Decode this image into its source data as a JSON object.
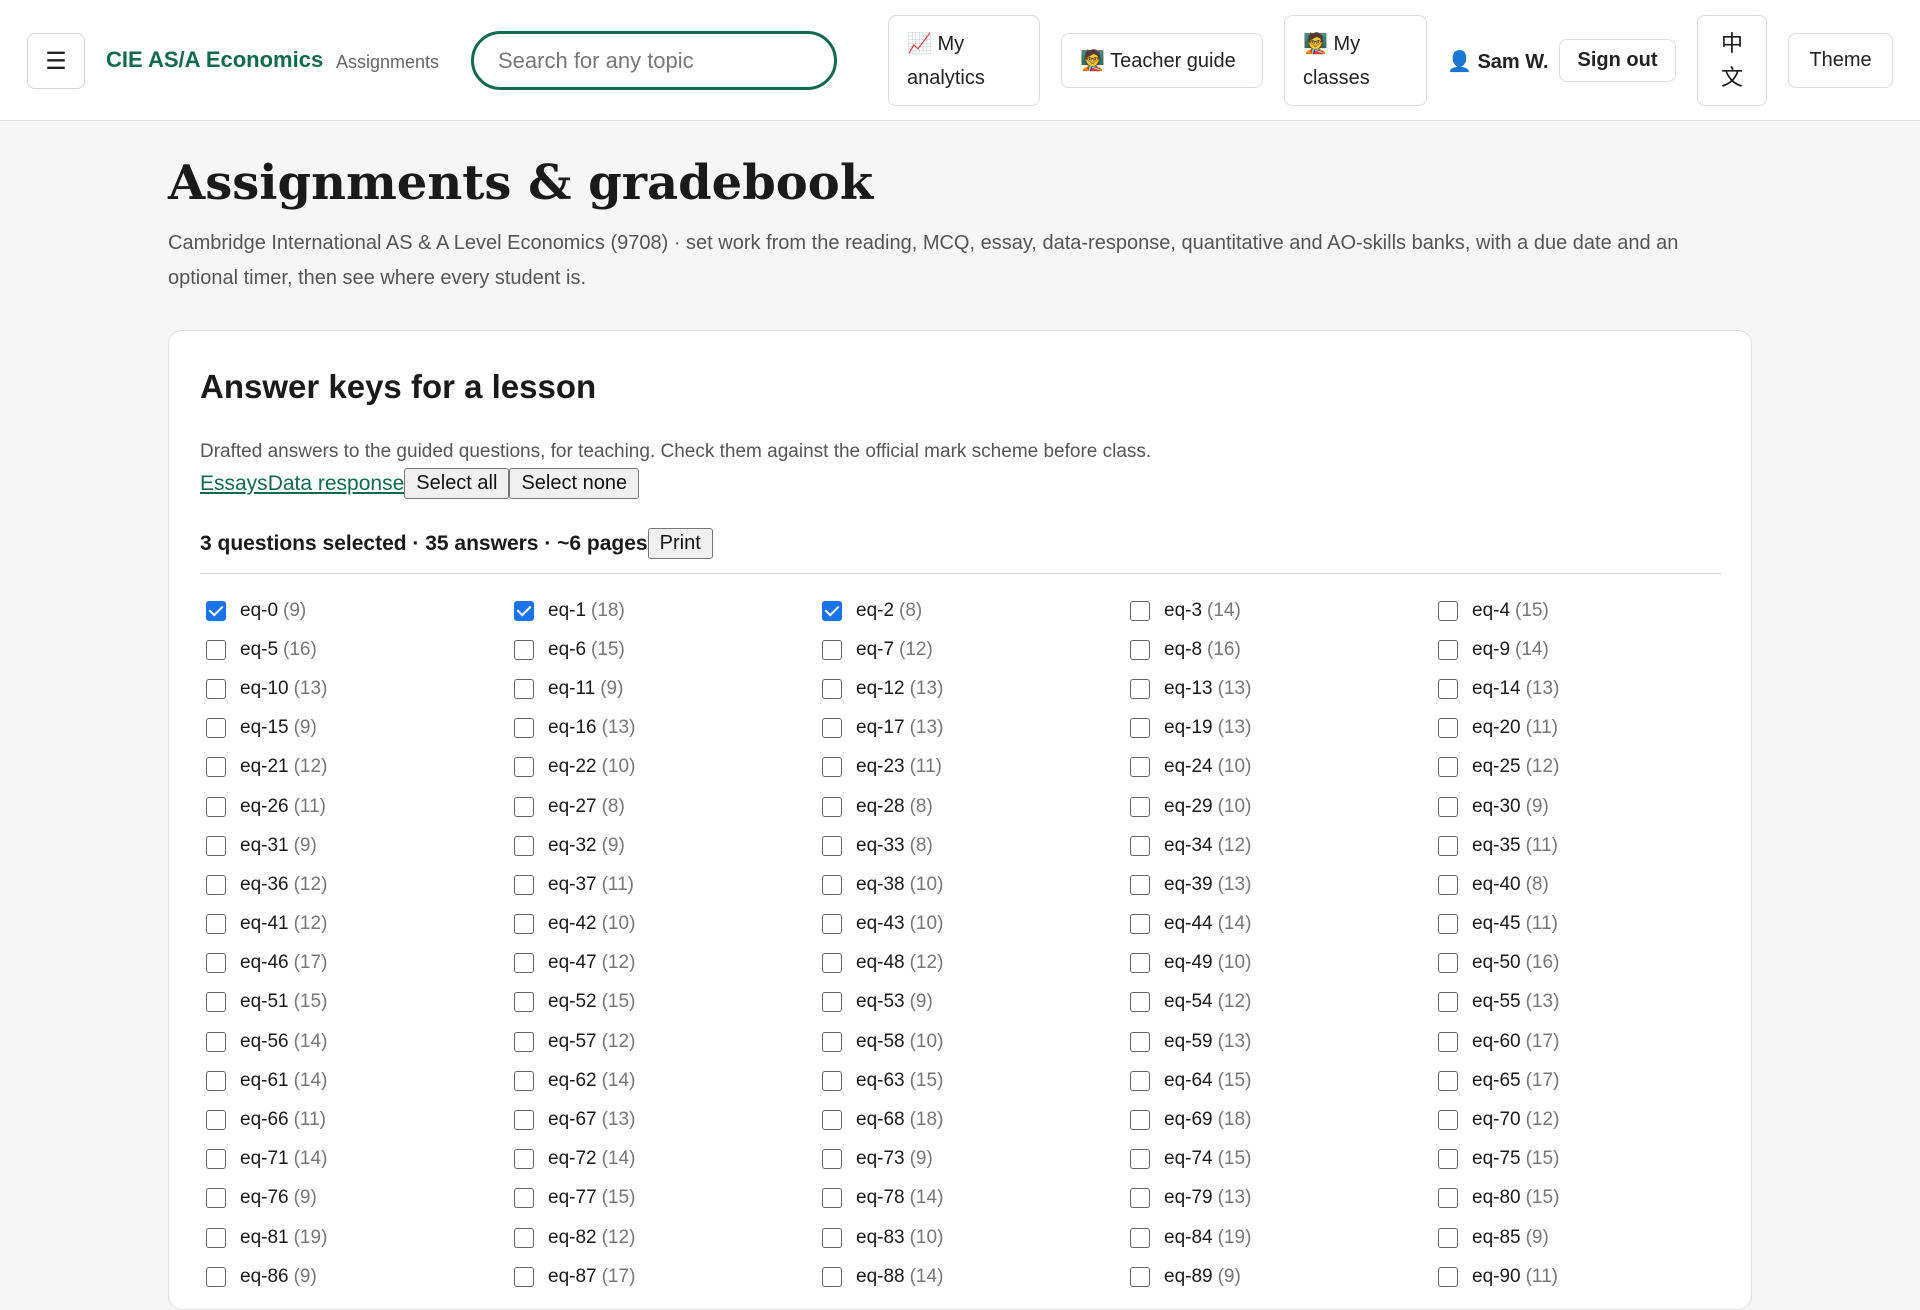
{
  "header": {
    "menu_icon": "☰",
    "brand": "CIE AS/A Economics",
    "brand_sub": "Assignments",
    "search_placeholder": "Search for any topic",
    "analytics_label": "📈 My analytics",
    "teacher_guide_label": "🧑‍🏫 Teacher guide",
    "classes_label": "🧑‍🏫 My classes",
    "user_label": "👤 Sam W.",
    "signout_label": "Sign out",
    "lang_label": "中文",
    "theme_label": "Theme"
  },
  "page": {
    "title": "Assignments & gradebook",
    "description": "Cambridge International AS & A Level Economics (9708) · set work from the reading, MCQ, essay, data-response, quantitative and AO-skills banks, with a due date and an optional timer, then see where every student is."
  },
  "card": {
    "title": "Answer keys for a lesson",
    "description": "Drafted answers to the guided questions, for teaching. Check them against the official mark scheme before class.",
    "tab_essays": "Essays",
    "tab_data": "Data response",
    "select_all": "Select all",
    "select_none": "Select none",
    "summary": "3 questions selected · 35 answers · ~6 pages",
    "print": "Print"
  },
  "questions": [
    {
      "id": "eq-0",
      "count": "(9)",
      "checked": true
    },
    {
      "id": "eq-1",
      "count": "(18)",
      "checked": true
    },
    {
      "id": "eq-2",
      "count": "(8)",
      "checked": true
    },
    {
      "id": "eq-3",
      "count": "(14)",
      "checked": false
    },
    {
      "id": "eq-4",
      "count": "(15)",
      "checked": false
    },
    {
      "id": "eq-5",
      "count": "(16)",
      "checked": false
    },
    {
      "id": "eq-6",
      "count": "(15)",
      "checked": false
    },
    {
      "id": "eq-7",
      "count": "(12)",
      "checked": false
    },
    {
      "id": "eq-8",
      "count": "(16)",
      "checked": false
    },
    {
      "id": "eq-9",
      "count": "(14)",
      "checked": false
    },
    {
      "id": "eq-10",
      "count": "(13)",
      "checked": false
    },
    {
      "id": "eq-11",
      "count": "(9)",
      "checked": false
    },
    {
      "id": "eq-12",
      "count": "(13)",
      "checked": false
    },
    {
      "id": "eq-13",
      "count": "(13)",
      "checked": false
    },
    {
      "id": "eq-14",
      "count": "(13)",
      "checked": false
    },
    {
      "id": "eq-15",
      "count": "(9)",
      "checked": false
    },
    {
      "id": "eq-16",
      "count": "(13)",
      "checked": false
    },
    {
      "id": "eq-17",
      "count": "(13)",
      "checked": false
    },
    {
      "id": "eq-19",
      "count": "(13)",
      "checked": false
    },
    {
      "id": "eq-20",
      "count": "(11)",
      "checked": false
    },
    {
      "id": "eq-21",
      "count": "(12)",
      "checked": false
    },
    {
      "id": "eq-22",
      "count": "(10)",
      "checked": false
    },
    {
      "id": "eq-23",
      "count": "(11)",
      "checked": false
    },
    {
      "id": "eq-24",
      "count": "(10)",
      "checked": false
    },
    {
      "id": "eq-25",
      "count": "(12)",
      "checked": false
    },
    {
      "id": "eq-26",
      "count": "(11)",
      "checked": false
    },
    {
      "id": "eq-27",
      "count": "(8)",
      "checked": false
    },
    {
      "id": "eq-28",
      "count": "(8)",
      "checked": false
    },
    {
      "id": "eq-29",
      "count": "(10)",
      "checked": false
    },
    {
      "id": "eq-30",
      "count": "(9)",
      "checked": false
    },
    {
      "id": "eq-31",
      "count": "(9)",
      "checked": false
    },
    {
      "id": "eq-32",
      "count": "(9)",
      "checked": false
    },
    {
      "id": "eq-33",
      "count": "(8)",
      "checked": false
    },
    {
      "id": "eq-34",
      "count": "(12)",
      "checked": false
    },
    {
      "id": "eq-35",
      "count": "(11)",
      "checked": false
    },
    {
      "id": "eq-36",
      "count": "(12)",
      "checked": false
    },
    {
      "id": "eq-37",
      "count": "(11)",
      "checked": false
    },
    {
      "id": "eq-38",
      "count": "(10)",
      "checked": false
    },
    {
      "id": "eq-39",
      "count": "(13)",
      "checked": false
    },
    {
      "id": "eq-40",
      "count": "(8)",
      "checked": false
    },
    {
      "id": "eq-41",
      "count": "(12)",
      "checked": false
    },
    {
      "id": "eq-42",
      "count": "(10)",
      "checked": false
    },
    {
      "id": "eq-43",
      "count": "(10)",
      "checked": false
    },
    {
      "id": "eq-44",
      "count": "(14)",
      "checked": false
    },
    {
      "id": "eq-45",
      "count": "(11)",
      "checked": false
    },
    {
      "id": "eq-46",
      "count": "(17)",
      "checked": false
    },
    {
      "id": "eq-47",
      "count": "(12)",
      "checked": false
    },
    {
      "id": "eq-48",
      "count": "(12)",
      "checked": false
    },
    {
      "id": "eq-49",
      "count": "(10)",
      "checked": false
    },
    {
      "id": "eq-50",
      "count": "(16)",
      "checked": false
    },
    {
      "id": "eq-51",
      "count": "(15)",
      "checked": false
    },
    {
      "id": "eq-52",
      "count": "(15)",
      "checked": false
    },
    {
      "id": "eq-53",
      "count": "(9)",
      "checked": false
    },
    {
      "id": "eq-54",
      "count": "(12)",
      "checked": false
    },
    {
      "id": "eq-55",
      "count": "(13)",
      "checked": false
    },
    {
      "id": "eq-56",
      "count": "(14)",
      "checked": false
    },
    {
      "id": "eq-57",
      "count": "(12)",
      "checked": false
    },
    {
      "id": "eq-58",
      "count": "(10)",
      "checked": false
    },
    {
      "id": "eq-59",
      "count": "(13)",
      "checked": false
    },
    {
      "id": "eq-60",
      "count": "(17)",
      "checked": false
    },
    {
      "id": "eq-61",
      "count": "(14)",
      "checked": false
    },
    {
      "id": "eq-62",
      "count": "(14)",
      "checked": false
    },
    {
      "id": "eq-63",
      "count": "(15)",
      "checked": false
    },
    {
      "id": "eq-64",
      "count": "(15)",
      "checked": false
    },
    {
      "id": "eq-65",
      "count": "(17)",
      "checked": false
    },
    {
      "id": "eq-66",
      "count": "(11)",
      "checked": false
    },
    {
      "id": "eq-67",
      "count": "(13)",
      "checked": false
    },
    {
      "id": "eq-68",
      "count": "(18)",
      "checked": false
    },
    {
      "id": "eq-69",
      "count": "(18)",
      "checked": false
    },
    {
      "id": "eq-70",
      "count": "(12)",
      "checked": false
    },
    {
      "id": "eq-71",
      "count": "(14)",
      "checked": false
    },
    {
      "id": "eq-72",
      "count": "(14)",
      "checked": false
    },
    {
      "id": "eq-73",
      "count": "(9)",
      "checked": false
    },
    {
      "id": "eq-74",
      "count": "(15)",
      "checked": false
    },
    {
      "id": "eq-75",
      "count": "(15)",
      "checked": false
    },
    {
      "id": "eq-76",
      "count": "(9)",
      "checked": false
    },
    {
      "id": "eq-77",
      "count": "(15)",
      "checked": false
    },
    {
      "id": "eq-78",
      "count": "(14)",
      "checked": false
    },
    {
      "id": "eq-79",
      "count": "(13)",
      "checked": false
    },
    {
      "id": "eq-80",
      "count": "(15)",
      "checked": false
    },
    {
      "id": "eq-81",
      "count": "(19)",
      "checked": false
    },
    {
      "id": "eq-82",
      "count": "(12)",
      "checked": false
    },
    {
      "id": "eq-83",
      "count": "(10)",
      "checked": false
    },
    {
      "id": "eq-84",
      "count": "(19)",
      "checked": false
    },
    {
      "id": "eq-85",
      "count": "(9)",
      "checked": false
    },
    {
      "id": "eq-86",
      "count": "(9)",
      "checked": false
    },
    {
      "id": "eq-87",
      "count": "(17)",
      "checked": false
    },
    {
      "id": "eq-88",
      "count": "(14)",
      "checked": false
    },
    {
      "id": "eq-89",
      "count": "(9)",
      "checked": false
    },
    {
      "id": "eq-90",
      "count": "(11)",
      "checked": false
    }
  ]
}
